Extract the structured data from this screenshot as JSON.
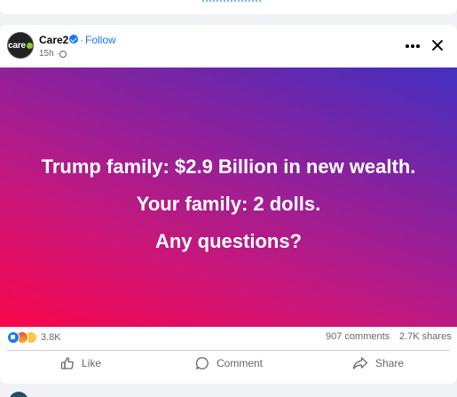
{
  "post": {
    "page_name": "Care2",
    "avatar_text": "care",
    "follow_label": "Follow",
    "time": "15h ·",
    "image_lines": [
      "Trump family: $2.9 Billion in new wealth.",
      "Your family: 2 dolls.",
      "Any questions?"
    ],
    "reaction_count": "3.8K",
    "comments": "907 comments",
    "shares": "2.7K shares",
    "actions": {
      "like": "Like",
      "comment": "Comment",
      "share": "Share"
    },
    "icons": [
      "verified-icon",
      "globe-icon",
      "more-icon",
      "close-icon",
      "like-icon",
      "comment-icon",
      "share-icon"
    ],
    "colors": {
      "link": "#1877f2",
      "muted": "#65676b",
      "gradient_start": "#f7064b",
      "gradient_end": "#4330c2"
    }
  }
}
